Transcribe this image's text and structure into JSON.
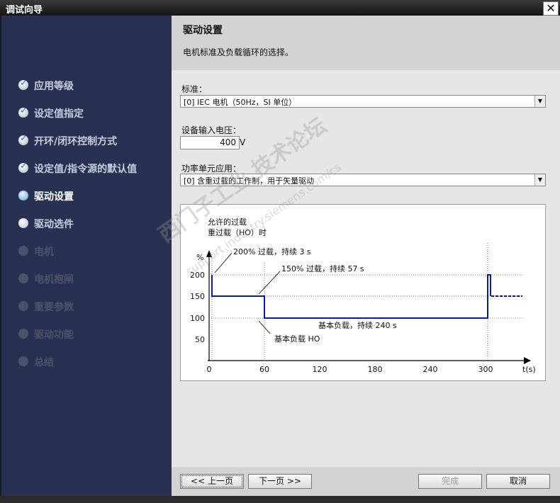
{
  "window": {
    "title": "调试向导",
    "close_glyph": "✕"
  },
  "sidebar": {
    "steps": [
      {
        "label": "应用等级",
        "state": "done"
      },
      {
        "label": "设定值指定",
        "state": "done"
      },
      {
        "label": "开环/闭环控制方式",
        "state": "done"
      },
      {
        "label": "设定值/指令源的默认值",
        "state": "done"
      },
      {
        "label": "驱动设置",
        "state": "current"
      },
      {
        "label": "驱动选件",
        "state": "next"
      },
      {
        "label": "电机",
        "state": "disabled"
      },
      {
        "label": "电机抱闸",
        "state": "disabled"
      },
      {
        "label": "重要参数",
        "state": "disabled"
      },
      {
        "label": "驱动功能",
        "state": "disabled"
      },
      {
        "label": "总结",
        "state": "disabled"
      }
    ]
  },
  "header": {
    "title": "驱动设置",
    "subtitle": "电机标准及负载循环的选择。"
  },
  "form": {
    "standard_label": "标准：",
    "standard_value": "[0] IEC 电机（50Hz，SI 单位）",
    "voltage_label": "设备输入电压：",
    "voltage_value": "400",
    "voltage_unit": "V",
    "power_unit_label": "功率单元应用：",
    "power_unit_value": "[0] 含重过载的工作制，用于矢量驱动"
  },
  "diagram": {
    "title_line1": "允许的过载",
    "title_line2": "重过载（HO）时",
    "y_unit": "%",
    "y_ticks": [
      "200",
      "150",
      "100",
      "50"
    ],
    "x_ticks": [
      "0",
      "60",
      "120",
      "180",
      "240",
      "300"
    ],
    "x_unit": "t(s)",
    "ann_200": "200% 过载，持续 3 s",
    "ann_150": "150% 过载，持续 57 s",
    "ann_base": "基本负载，持续 240 s",
    "ann_ho": "基本负载 HO",
    "line_color": "#0a1aa8"
  },
  "watermark": {
    "line1": "西门子工业 技术论坛",
    "line2": "support.industry.siemens.com/cs"
  },
  "footer": {
    "prev": "<< 上一页",
    "next": "下一页 >>",
    "finish": "完成",
    "cancel": "取消"
  }
}
